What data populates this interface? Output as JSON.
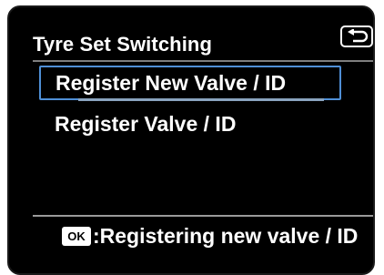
{
  "screen": {
    "title": "Tyre Set Switching",
    "back_icon": "return-arrow-icon"
  },
  "menu": {
    "items": [
      {
        "label": "Register New Valve / ID",
        "selected": true
      },
      {
        "label": "Register Valve / ID",
        "selected": false
      }
    ]
  },
  "status_bar": {
    "ok_badge": "OK",
    "text": ":Registering new valve / ID"
  },
  "colors": {
    "background": "#000000",
    "text": "#ffffff",
    "selection_border": "#4f8fd6",
    "divider": "#8a8a8a"
  }
}
